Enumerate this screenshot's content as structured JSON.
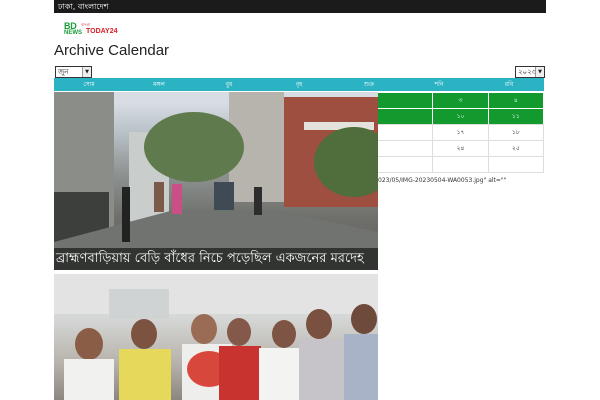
{
  "topbar": {
    "location": "ঢাকা, বাংলাদেশ"
  },
  "logo": {
    "line1": "BD",
    "line2": "NEWS",
    "line3": "TODAY24",
    "tag": "বাংলা"
  },
  "page": {
    "title": "Archive Calendar"
  },
  "selects": {
    "month": "জুন",
    "year": "২০২৩"
  },
  "calendar": {
    "days": [
      "সোম",
      "মঙ্গল",
      "বুধ",
      "বৃহ",
      "শুক্র",
      "শনি",
      "রবি"
    ],
    "rows": [
      [
        "",
        "৩",
        "৪"
      ],
      [
        "",
        "১০",
        "১১"
      ],
      [
        "",
        "১৭",
        "১৮"
      ],
      [
        "",
        "২৪",
        "২৫"
      ],
      [
        "",
        "",
        ""
      ]
    ]
  },
  "stray_text": "023/05/IMG-20230504-WA0053.jpg\" alt=\"\"",
  "articles": [
    {
      "caption": "ব্রাহ্মণবাড়িয়ায় বেড়ি বাঁধের নিচে পড়েছিল একজনের মরদেহ"
    }
  ],
  "colors": {
    "header_bar": "#1b1b1b",
    "calendar_header": "#2bb3c4",
    "calendar_active": "#139a2f",
    "logo_green": "#1a9b3a",
    "logo_red": "#d81f26"
  }
}
